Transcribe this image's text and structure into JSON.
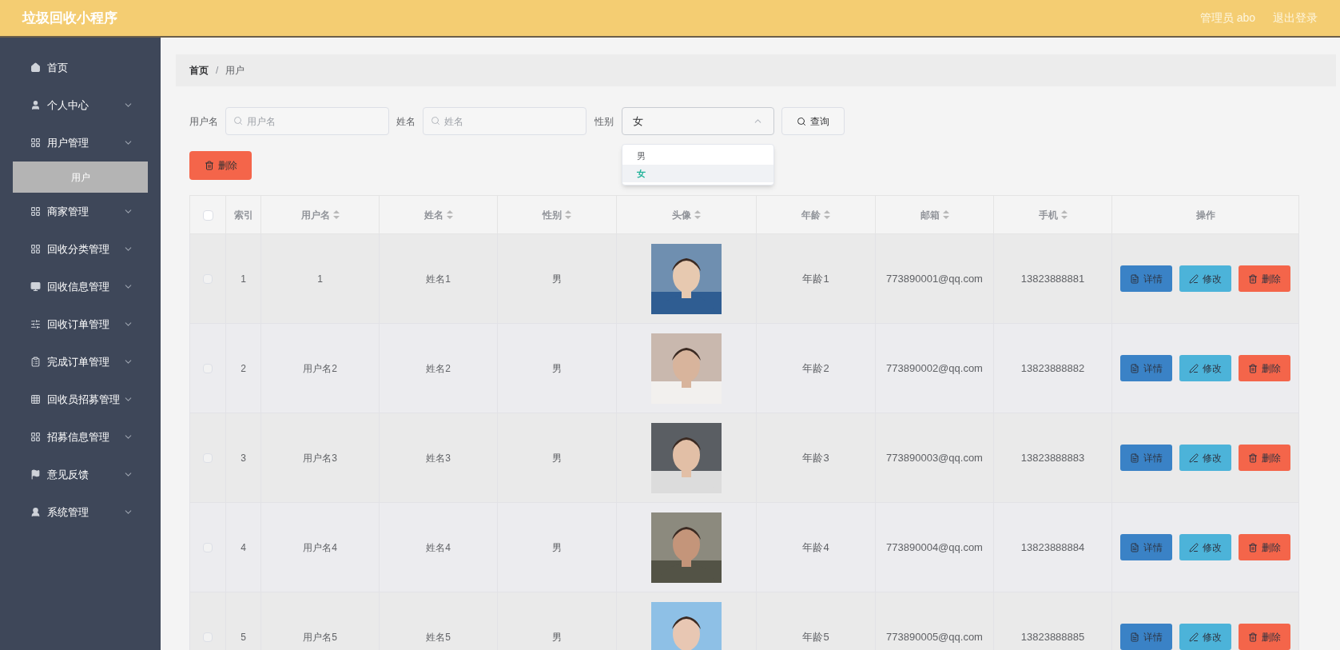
{
  "header": {
    "title": "垃圾回收小程序",
    "user": "管理员 abo",
    "logout": "退出登录"
  },
  "sidebar": {
    "items": [
      {
        "label": "首页",
        "expandable": false,
        "selected": false
      },
      {
        "label": "个人中心",
        "expandable": true,
        "selected": false
      },
      {
        "label": "用户管理",
        "expandable": true,
        "selected": false,
        "children": [
          {
            "label": "用户",
            "selected": true
          }
        ]
      },
      {
        "label": "商家管理",
        "expandable": true,
        "selected": false
      },
      {
        "label": "回收分类管理",
        "expandable": true,
        "selected": false
      },
      {
        "label": "回收信息管理",
        "expandable": true,
        "selected": false
      },
      {
        "label": "回收订单管理",
        "expandable": true,
        "selected": false
      },
      {
        "label": "完成订单管理",
        "expandable": true,
        "selected": false
      },
      {
        "label": "回收员招募管理",
        "expandable": true,
        "selected": false
      },
      {
        "label": "招募信息管理",
        "expandable": true,
        "selected": false
      },
      {
        "label": "意见反馈",
        "expandable": true,
        "selected": false
      },
      {
        "label": "系统管理",
        "expandable": true,
        "selected": false
      }
    ]
  },
  "breadcrumb": [
    {
      "label": "首页",
      "current": false
    },
    {
      "label": "用户",
      "current": true
    }
  ],
  "breadcrumb_separator": "/",
  "search": {
    "fields": [
      {
        "label": "用户名",
        "placeholder": "用户名"
      },
      {
        "label": "姓名",
        "placeholder": "姓名"
      }
    ],
    "gender": {
      "label": "性别",
      "value": "女",
      "expanded": true,
      "options": [
        {
          "label": "男",
          "selected": false
        },
        {
          "label": "女",
          "selected": true
        }
      ]
    },
    "query_button": "查询"
  },
  "delete_button": "删除",
  "table": {
    "select_all_checked": false,
    "columns": [
      {
        "label": "索引",
        "sortable": false
      },
      {
        "label": "用户名",
        "sortable": true
      },
      {
        "label": "姓名",
        "sortable": true
      },
      {
        "label": "性别",
        "sortable": true
      },
      {
        "label": "头像",
        "sortable": true
      },
      {
        "label": "年龄",
        "sortable": true
      },
      {
        "label": "邮箱",
        "sortable": true
      },
      {
        "label": "手机",
        "sortable": true
      },
      {
        "label": "操作",
        "sortable": false
      }
    ],
    "rows": [
      {
        "checked": false,
        "index": "1",
        "username": "1",
        "name": "姓名1",
        "gender": "男",
        "age": "年龄1",
        "email": "773890001@qq.com",
        "phone": "13823888881",
        "actions": [
          {
            "kind": "detail",
            "label": "详情"
          },
          {
            "kind": "edit",
            "label": "修改"
          },
          {
            "kind": "delete",
            "label": "删除"
          }
        ]
      },
      {
        "checked": false,
        "index": "2",
        "username": "用户名2",
        "name": "姓名2",
        "gender": "男",
        "age": "年龄2",
        "email": "773890002@qq.com",
        "phone": "13823888882",
        "actions": [
          {
            "kind": "detail",
            "label": "详情"
          },
          {
            "kind": "edit",
            "label": "修改"
          },
          {
            "kind": "delete",
            "label": "删除"
          }
        ]
      },
      {
        "checked": false,
        "index": "3",
        "username": "用户名3",
        "name": "姓名3",
        "gender": "男",
        "age": "年龄3",
        "email": "773890003@qq.com",
        "phone": "13823888883",
        "actions": [
          {
            "kind": "detail",
            "label": "详情"
          },
          {
            "kind": "edit",
            "label": "修改"
          },
          {
            "kind": "delete",
            "label": "删除"
          }
        ]
      },
      {
        "checked": false,
        "index": "4",
        "username": "用户名4",
        "name": "姓名4",
        "gender": "男",
        "age": "年龄4",
        "email": "773890004@qq.com",
        "phone": "13823888884",
        "actions": [
          {
            "kind": "detail",
            "label": "详情"
          },
          {
            "kind": "edit",
            "label": "修改"
          },
          {
            "kind": "delete",
            "label": "删除"
          }
        ]
      },
      {
        "checked": false,
        "index": "5",
        "username": "用户名5",
        "name": "姓名5",
        "gender": "男",
        "age": "年龄5",
        "email": "773890005@qq.com",
        "phone": "13823888885",
        "actions": [
          {
            "kind": "detail",
            "label": "详情"
          },
          {
            "kind": "edit",
            "label": "修改"
          },
          {
            "kind": "delete",
            "label": "删除"
          }
        ]
      }
    ]
  }
}
